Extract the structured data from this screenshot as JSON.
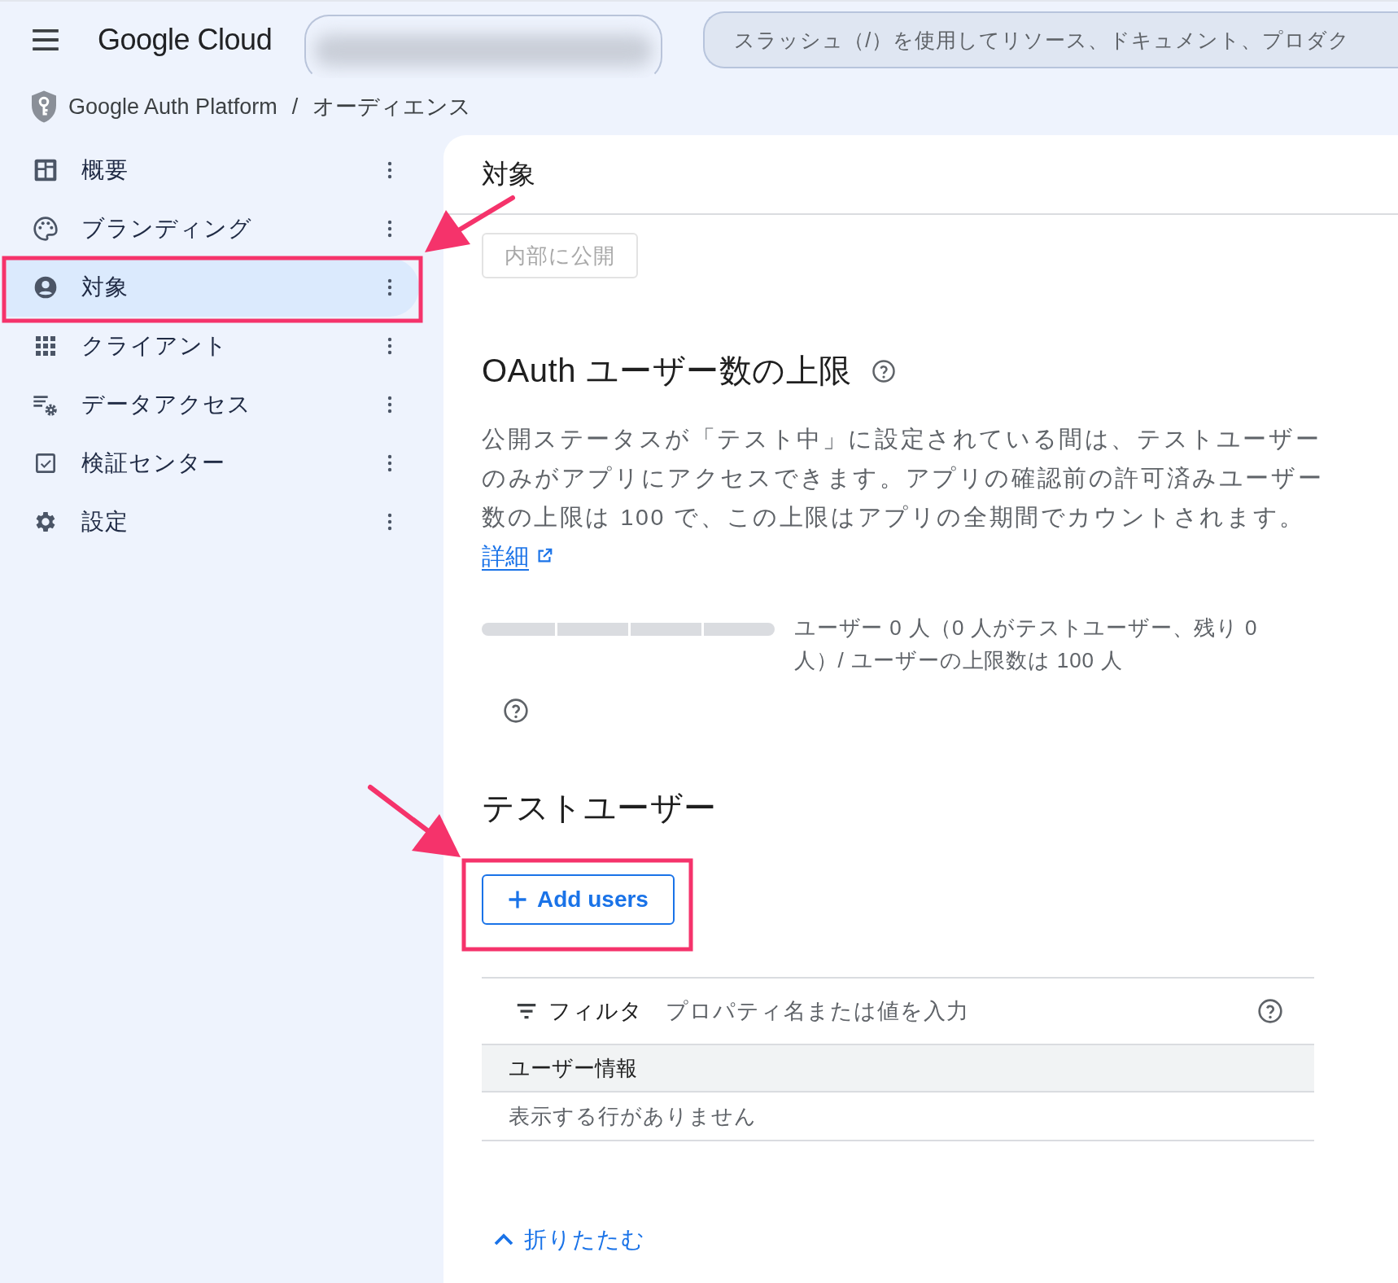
{
  "header": {
    "logo": "Google Cloud",
    "search": {
      "placeholder": "スラッシュ（/）を使用してリソース、ドキュメント、プロダク"
    }
  },
  "breadcrumb": {
    "items": [
      "Google Auth Platform",
      "オーディエンス"
    ],
    "separator": "/"
  },
  "sidebar": {
    "items": [
      {
        "label": "概要",
        "selected": false
      },
      {
        "label": "ブランディング",
        "selected": false
      },
      {
        "label": "対象",
        "selected": true
      },
      {
        "label": "クライアント",
        "selected": false
      },
      {
        "label": "データアクセス",
        "selected": false
      },
      {
        "label": "検証センター",
        "selected": false
      },
      {
        "label": "設定",
        "selected": false
      }
    ]
  },
  "main": {
    "title": "対象",
    "publish_button": {
      "label": "内部に公開",
      "disabled": true
    },
    "oauth": {
      "heading": "OAuth ユーザー数の上限",
      "description": "公開ステータスが「テスト中」に設定されている間は、テストユーザーのみがアプリにアクセスできます。アプリの確認前の許可済みユーザー数の上限は 100 で、この上限はアプリの全期間でカウントされます。",
      "link": "詳細",
      "usage": {
        "text": "ユーザー 0 人（0 人がテストユーザー、残り 0 人）/ ユーザーの上限数は 100 人"
      }
    },
    "test_users": {
      "heading": "テストユーザー",
      "add_button": "Add users",
      "filter": {
        "label": "フィルタ",
        "placeholder": "プロパティ名または値を入力"
      },
      "table": {
        "columns": [
          "ユーザー情報"
        ],
        "empty_text": "表示する行がありません"
      }
    },
    "collapse": "折りたたむ"
  }
}
